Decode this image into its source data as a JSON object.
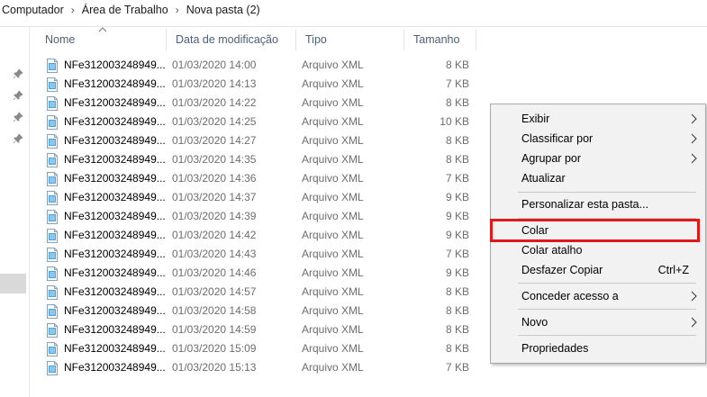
{
  "breadcrumb": [
    "Computador",
    "Área de Trabalho",
    "Nova pasta (2)"
  ],
  "columns": {
    "name": "Nome",
    "date": "Data de modificação",
    "type": "Tipo",
    "size": "Tamanho"
  },
  "files": [
    {
      "name": "NFe312003248949...",
      "date": "01/03/2020 14:00",
      "type": "Arquivo XML",
      "size": "8 KB"
    },
    {
      "name": "NFe312003248949...",
      "date": "01/03/2020 14:13",
      "type": "Arquivo XML",
      "size": "7 KB"
    },
    {
      "name": "NFe312003248949...",
      "date": "01/03/2020 14:22",
      "type": "Arquivo XML",
      "size": "8 KB"
    },
    {
      "name": "NFe312003248949...",
      "date": "01/03/2020 14:25",
      "type": "Arquivo XML",
      "size": "10 KB"
    },
    {
      "name": "NFe312003248949...",
      "date": "01/03/2020 14:27",
      "type": "Arquivo XML",
      "size": "8 KB"
    },
    {
      "name": "NFe312003248949...",
      "date": "01/03/2020 14:35",
      "type": "Arquivo XML",
      "size": "8 KB"
    },
    {
      "name": "NFe312003248949...",
      "date": "01/03/2020 14:36",
      "type": "Arquivo XML",
      "size": "7 KB"
    },
    {
      "name": "NFe312003248949...",
      "date": "01/03/2020 14:37",
      "type": "Arquivo XML",
      "size": "9 KB"
    },
    {
      "name": "NFe312003248949...",
      "date": "01/03/2020 14:39",
      "type": "Arquivo XML",
      "size": "9 KB"
    },
    {
      "name": "NFe312003248949...",
      "date": "01/03/2020 14:42",
      "type": "Arquivo XML",
      "size": "9 KB"
    },
    {
      "name": "NFe312003248949...",
      "date": "01/03/2020 14:43",
      "type": "Arquivo XML",
      "size": "7 KB"
    },
    {
      "name": "NFe312003248949...",
      "date": "01/03/2020 14:46",
      "type": "Arquivo XML",
      "size": "9 KB"
    },
    {
      "name": "NFe312003248949...",
      "date": "01/03/2020 14:57",
      "type": "Arquivo XML",
      "size": "8 KB"
    },
    {
      "name": "NFe312003248949...",
      "date": "01/03/2020 14:58",
      "type": "Arquivo XML",
      "size": "8 KB"
    },
    {
      "name": "NFe312003248949...",
      "date": "01/03/2020 14:59",
      "type": "Arquivo XML",
      "size": "8 KB"
    },
    {
      "name": "NFe312003248949...",
      "date": "01/03/2020 15:09",
      "type": "Arquivo XML",
      "size": "8 KB"
    },
    {
      "name": "NFe312003248949...",
      "date": "01/03/2020 15:13",
      "type": "Arquivo XML",
      "size": "7 KB"
    }
  ],
  "context_menu": {
    "exibir": "Exibir",
    "classificar": "Classificar por",
    "agrupar": "Agrupar por",
    "atualizar": "Atualizar",
    "personalizar": "Personalizar esta pasta...",
    "colar": "Colar",
    "colar_atalho": "Colar atalho",
    "desfazer": "Desfazer Copiar",
    "desfazer_shortcut": "Ctrl+Z",
    "conceder": "Conceder acesso a",
    "novo": "Novo",
    "propriedades": "Propriedades"
  },
  "colors": {
    "highlight_border": "#e01a1a",
    "header_text": "#4c607a",
    "menu_bg": "#f2f2f2"
  },
  "icons": {
    "file": "xml-file-icon",
    "pin": "pin-icon",
    "submenu": "chevron-right-icon",
    "sort": "sort-up-icon"
  }
}
